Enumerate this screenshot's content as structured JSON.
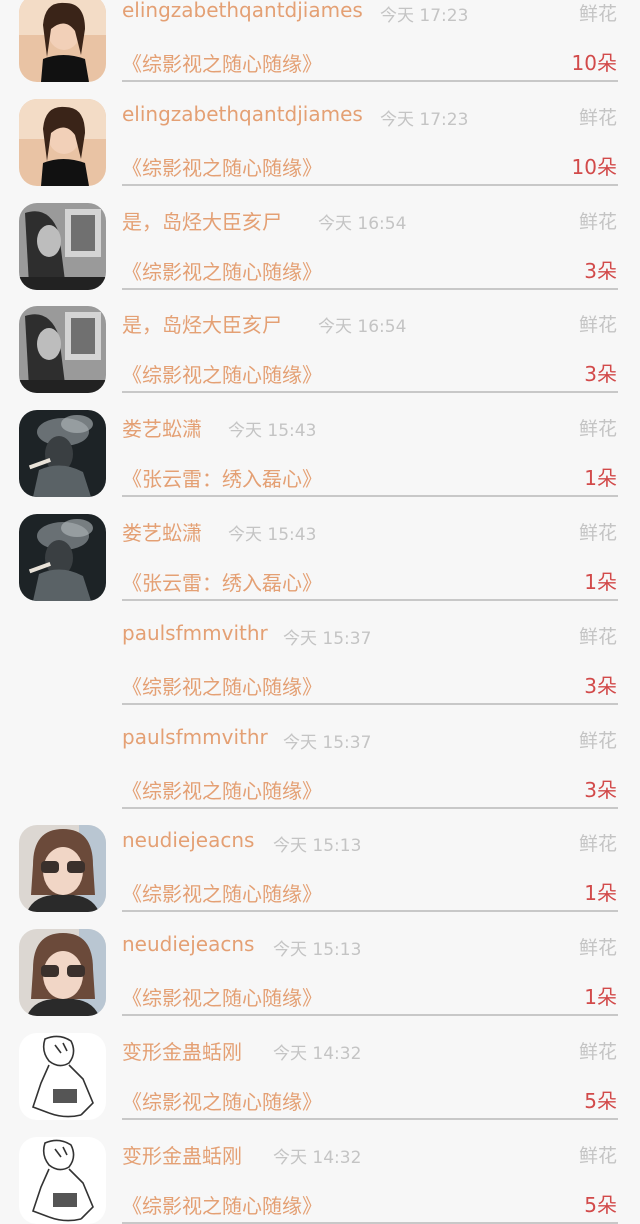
{
  "rows": [
    {
      "name": "elingzabethqantdjiames",
      "time": "今天 17:23",
      "gift_type": "鲜花",
      "work": "《综影视之随心随缘》",
      "count": "10朵",
      "avatar": "woman-black-top"
    },
    {
      "name": "elingzabethqantdjiames",
      "time": "今天 17:23",
      "gift_type": "鲜花",
      "work": "《综影视之随心随缘》",
      "count": "10朵",
      "avatar": "woman-black-top"
    },
    {
      "name": "是，岛烃大臣亥尸",
      "time": "今天 16:54",
      "gift_type": "鲜花",
      "work": "《综影视之随心随缘》",
      "count": "3朵",
      "avatar": "grayscale-portrait"
    },
    {
      "name": "是，岛烃大臣亥尸",
      "time": "今天 16:54",
      "gift_type": "鲜花",
      "work": "《综影视之随心随缘》",
      "count": "3朵",
      "avatar": "grayscale-portrait"
    },
    {
      "name": "娄艺蚣潇",
      "time": "今天 15:43",
      "gift_type": "鲜花",
      "work": "《张云雷：绣入磊心》",
      "count": "1朵",
      "avatar": "smoke-portrait"
    },
    {
      "name": "娄艺蚣潇",
      "time": "今天 15:43",
      "gift_type": "鲜花",
      "work": "《张云雷：绣入磊心》",
      "count": "1朵",
      "avatar": "smoke-portrait"
    },
    {
      "name": "paulsfmmvithr",
      "time": "今天 15:37",
      "gift_type": "鲜花",
      "work": "《综影视之随心随缘》",
      "count": "3朵",
      "avatar": "none"
    },
    {
      "name": "paulsfmmvithr",
      "time": "今天 15:37",
      "gift_type": "鲜花",
      "work": "《综影视之随心随缘》",
      "count": "3朵",
      "avatar": "none"
    },
    {
      "name": "neudiejeacns",
      "time": "今天 15:13",
      "gift_type": "鲜花",
      "work": "《综影视之随心随缘》",
      "count": "1朵",
      "avatar": "girl-glasses"
    },
    {
      "name": "neudiejeacns",
      "time": "今天 15:13",
      "gift_type": "鲜花",
      "work": "《综影视之随心随缘》",
      "count": "1朵",
      "avatar": "girl-glasses"
    },
    {
      "name": "变形金蛊蛞刚",
      "time": "今天 14:32",
      "gift_type": "鲜花",
      "work": "《综影视之随心随缘》",
      "count": "5朵",
      "avatar": "sketch-drawing"
    },
    {
      "name": "变形金蛊蛞刚",
      "time": "今天 14:32",
      "gift_type": "鲜花",
      "work": "《综影视之随心随缘》",
      "count": "5朵",
      "avatar": "sketch-drawing"
    }
  ],
  "colors": {
    "background": "#f7f7f7",
    "name": "#e4a074",
    "time": "#c4c4c4",
    "count": "#d24a4a",
    "divider": "#c8c8c8"
  }
}
